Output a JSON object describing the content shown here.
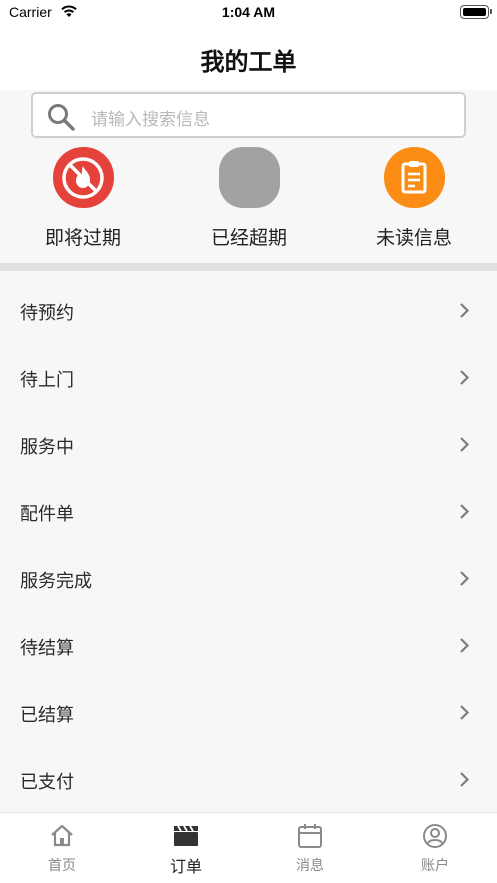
{
  "status_bar": {
    "carrier": "Carrier",
    "time": "1:04 AM"
  },
  "header": {
    "title": "我的工单"
  },
  "search": {
    "placeholder": "请输入搜索信息"
  },
  "quick_actions": [
    {
      "label": "即将过期",
      "icon": "no-fire-icon",
      "color": "#e5423c"
    },
    {
      "label": "已经超期",
      "icon": "grey-circle-icon",
      "color": "#a2a2a2"
    },
    {
      "label": "未读信息",
      "icon": "document-icon",
      "color": "#fb8c14"
    }
  ],
  "list": [
    {
      "label": "待预约"
    },
    {
      "label": "待上门"
    },
    {
      "label": "服务中"
    },
    {
      "label": "配件单"
    },
    {
      "label": "服务完成"
    },
    {
      "label": "待结算"
    },
    {
      "label": "已结算"
    },
    {
      "label": "已支付"
    }
  ],
  "tabs": [
    {
      "label": "首页",
      "icon": "home-icon",
      "active": false
    },
    {
      "label": "订单",
      "icon": "clapperboard-icon",
      "active": true
    },
    {
      "label": "消息",
      "icon": "calendar-icon",
      "active": false
    },
    {
      "label": "账户",
      "icon": "user-circle-icon",
      "active": false
    }
  ]
}
